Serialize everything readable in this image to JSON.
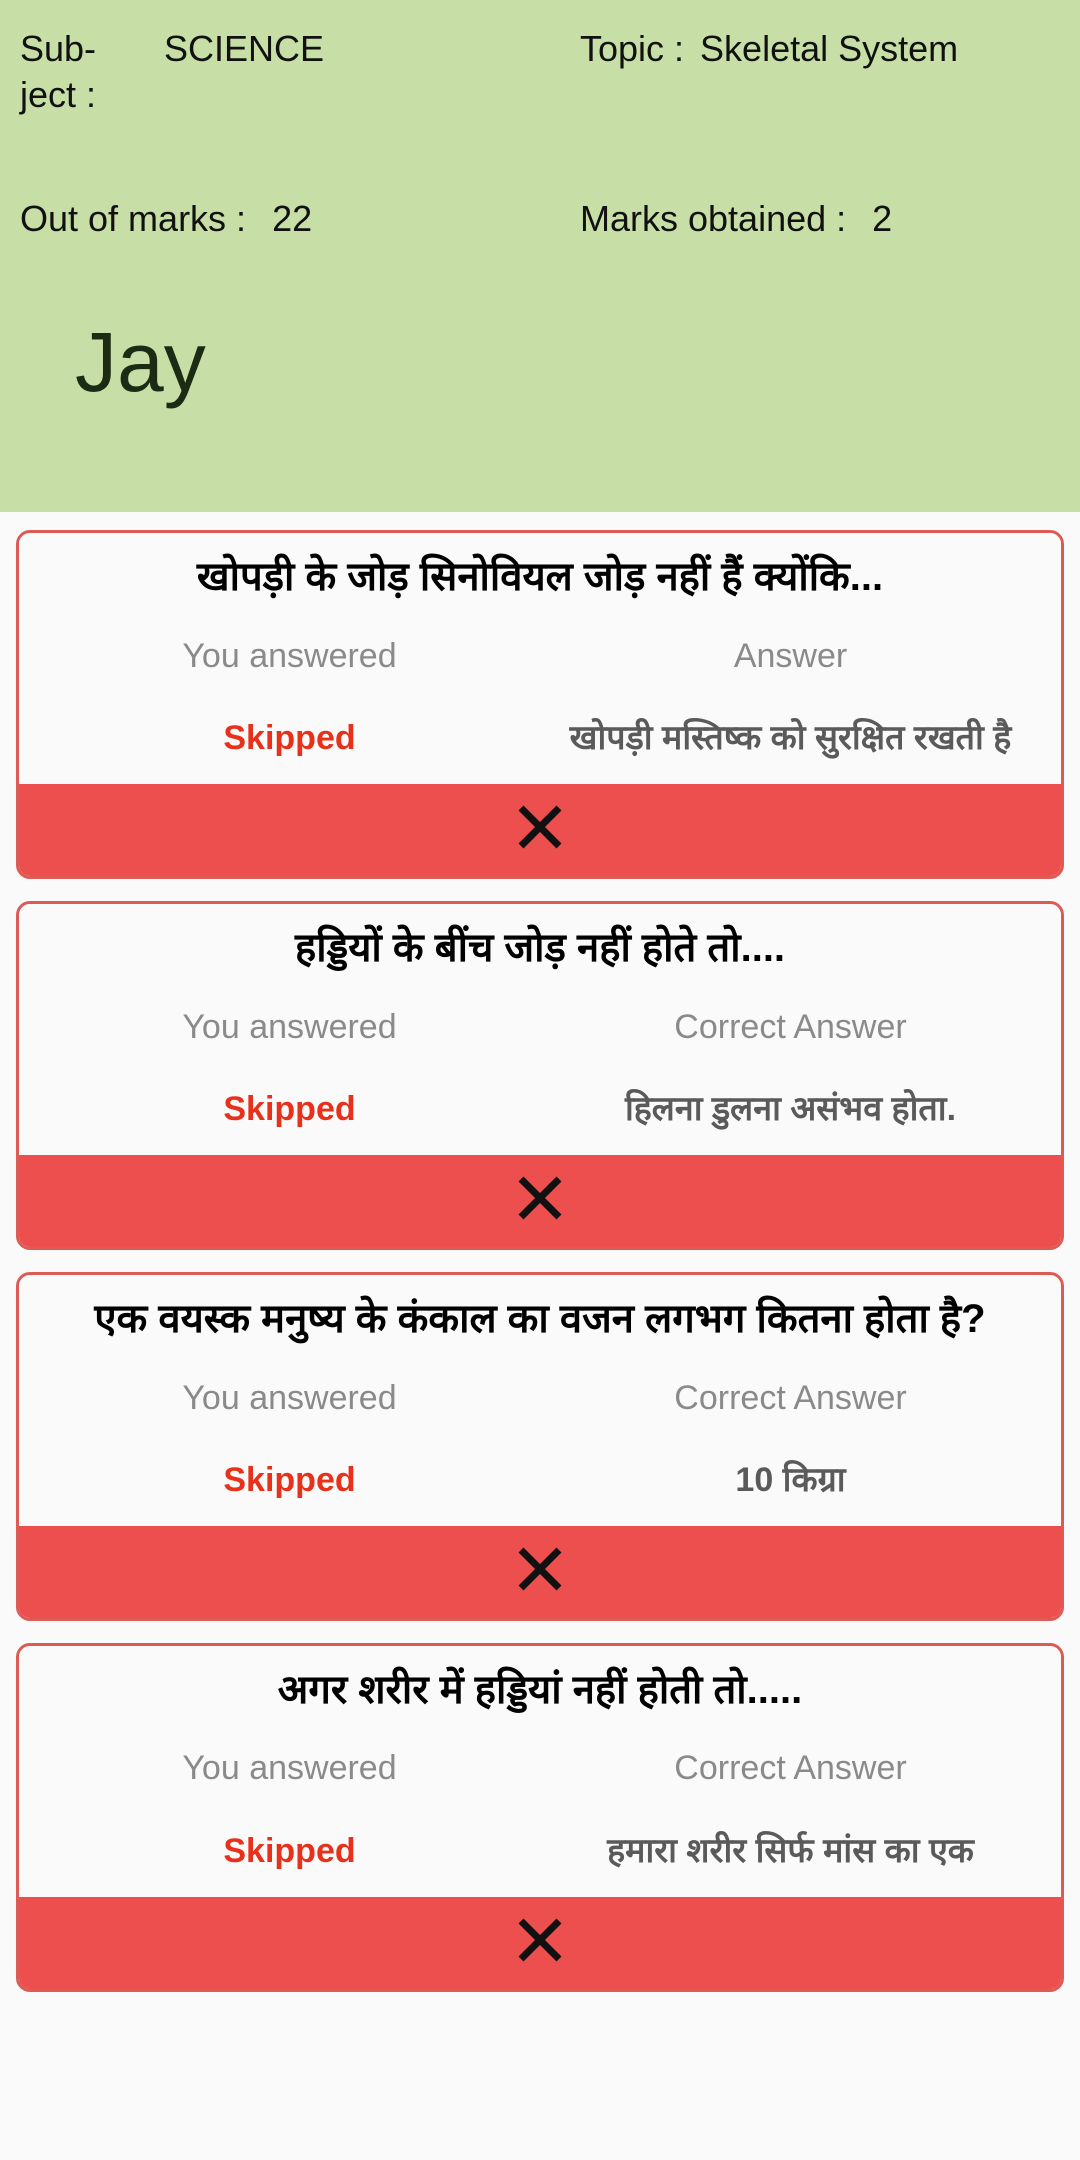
{
  "header": {
    "subject_label": "Subject :",
    "subject_label_line1": "Sub-",
    "subject_label_line2": "ject :",
    "subject_value": "SCIENCE",
    "topic_label": "Topic :",
    "topic_value": "Skeletal System",
    "out_of_marks_label": "Out of marks :",
    "out_of_marks_value": "22",
    "marks_obtained_label": "Marks obtained :",
    "marks_obtained_value": "2",
    "student_name": "Jay",
    "background_color": "#c7dfa6"
  },
  "colors": {
    "card_border": "#dd5b55",
    "footer_red": "#ec4f4e",
    "skipped_red": "#e8311a",
    "label_gray": "#8a8a8a",
    "answer_gray": "#5a5a5a",
    "page_background": "#fafafa"
  },
  "results": [
    {
      "question": "खोपड़ी के जोड़ सिनोवियल जोड़ नहीं हैं क्योंकि...",
      "you_answered_label": "You answered",
      "you_answered_value": "Skipped",
      "answer_label": "Answer",
      "answer_value": "खोपड़ी मस्तिष्क को सुरक्षित रखती है",
      "status_icon": "cross-icon",
      "status": "incorrect"
    },
    {
      "question": "हड्डियों के बींच जोड़ नहीं होते तो....",
      "you_answered_label": "You answered",
      "you_answered_value": "Skipped",
      "answer_label": "Correct Answer",
      "answer_value": "हिलना डुलना असंभव होता.",
      "status_icon": "cross-icon",
      "status": "incorrect"
    },
    {
      "question": "एक वयस्क मनुष्य के कंकाल का वजन लगभग कितना होता है?",
      "you_answered_label": "You answered",
      "you_answered_value": "Skipped",
      "answer_label": "Correct Answer",
      "answer_value": "10 किग्रा",
      "status_icon": "cross-icon",
      "status": "incorrect"
    },
    {
      "question": "अगर शरीर में हड्डियां नहीं होती तो.....",
      "you_answered_label": "You answered",
      "you_answered_value": "Skipped",
      "answer_label": "Correct Answer",
      "answer_value": "हमारा शरीर सिर्फ मांस का एक",
      "status_icon": "cross-icon",
      "status": "incorrect"
    }
  ]
}
